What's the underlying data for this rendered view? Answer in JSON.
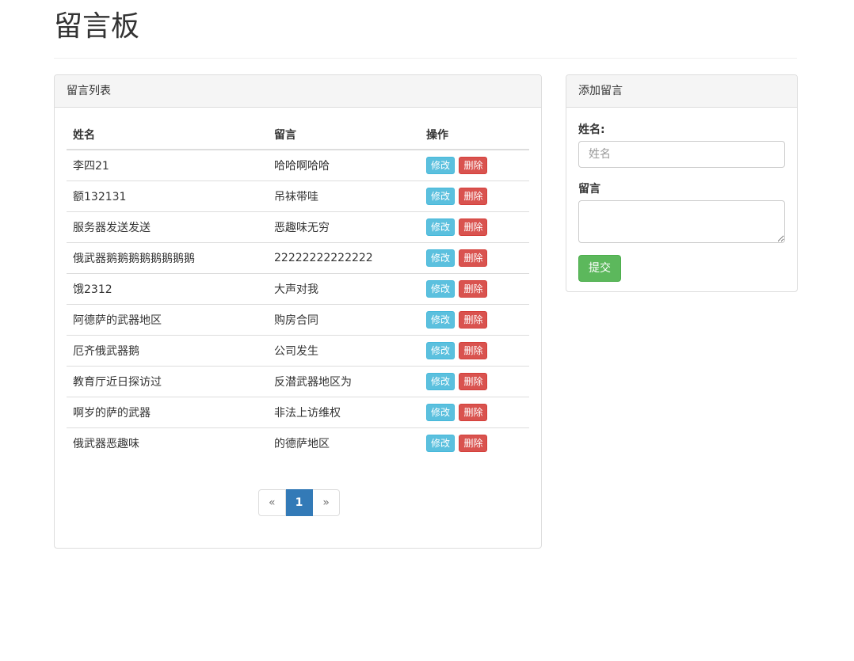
{
  "page": {
    "title": "留言板"
  },
  "list_panel": {
    "heading": "留言列表",
    "columns": [
      "姓名",
      "留言",
      "操作"
    ],
    "rows": [
      {
        "name": "李四21",
        "message": "哈哈啊哈哈"
      },
      {
        "name": "额132131",
        "message": "吊袜带哇"
      },
      {
        "name": "服务器发送发送",
        "message": "恶趣味无穷"
      },
      {
        "name": "俄武器鹅鹅鹅鹅鹅鹅鹅鹅",
        "message": "22222222222222"
      },
      {
        "name": "饿2312",
        "message": "大声对我"
      },
      {
        "name": "阿德萨的武器地区",
        "message": "购房合同"
      },
      {
        "name": "厄齐俄武器鹅",
        "message": "公司发生"
      },
      {
        "name": "教育厅近日探访过",
        "message": "反潜武器地区为"
      },
      {
        "name": "啊岁的萨的武器",
        "message": "非法上访维权"
      },
      {
        "name": "俄武器恶趣味",
        "message": "的德萨地区"
      }
    ],
    "edit_label": "修改",
    "delete_label": "删除",
    "pagination": {
      "prev": "«",
      "current": "1",
      "next": "»"
    }
  },
  "add_panel": {
    "heading": "添加留言",
    "name_label": "姓名:",
    "name_placeholder": "姓名",
    "message_label": "留言",
    "submit_label": "提交"
  },
  "colors": {
    "info": "#5bc0de",
    "danger": "#d9534f",
    "success": "#5cb85c",
    "primary": "#337ab7"
  }
}
